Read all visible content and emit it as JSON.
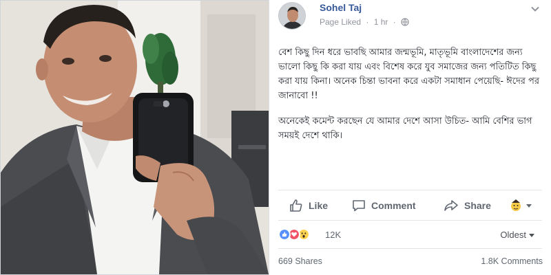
{
  "post": {
    "author": "Sohel Taj",
    "page_liked": "Page Liked",
    "separator": "·",
    "time": "1 hr",
    "paragraphs": [
      "বেশ কিছু দিন ধরে ভাবছি আমার জন্মভূমি, মাতৃভূমি বাংলাদেশের জন্য ভালো কিছু কি করা যায় এবং বিশেষ করে যুব সমাজের জন্য পতিটিত কিছু করা যায় কিনা। অনেক চিন্তা ভাবনা করে একটা সমাধান পেয়েছি- ঈদের পর জানাবো !!",
      "অনেকেই কমেন্ট করছেন যে আমার দেশে আসা উচিত- আমি বেশির ভাগ সময়ই দেশে থাকি।"
    ]
  },
  "actions": {
    "like": "Like",
    "comment": "Comment",
    "share": "Share"
  },
  "summary": {
    "reactions": [
      "like",
      "love",
      "wow"
    ],
    "reaction_count": "12K",
    "sort": "Oldest"
  },
  "footer": {
    "shares": "669 Shares",
    "comments": "1.8K Comments"
  },
  "colors": {
    "brand_blue": "#365899",
    "action_gray": "#606770",
    "like_blue": "#5890ff",
    "love_red": "#f25268",
    "wow_yellow": "#fdd24e"
  },
  "icons": [
    "thumbs-up-icon",
    "comment-bubble-icon",
    "share-arrow-icon",
    "reaction-emoji-icon",
    "globe-icon",
    "chevron-down-icon"
  ]
}
